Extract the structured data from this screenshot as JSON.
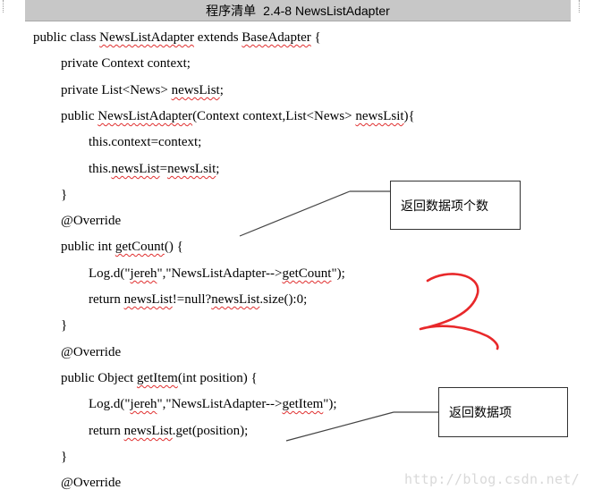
{
  "listing": {
    "label": "程序清单",
    "name": "2.4-8 NewsListAdapter"
  },
  "lines": [
    [
      "public class ",
      {
        "w": "NewsListAdapter"
      },
      " extends ",
      {
        "w": "BaseAdapter"
      },
      " {"
    ],
    [
      "private Context context;"
    ],
    [
      "private List<News> ",
      {
        "w": "newsList"
      },
      ";"
    ],
    [
      "public ",
      {
        "w": "NewsListAdapter"
      },
      "(Context context,List<News> ",
      {
        "w": "newsLsit"
      },
      "){"
    ],
    [
      "this.context=context;"
    ],
    [
      "this.",
      {
        "w": "newsList"
      },
      "=",
      {
        "w": "newsLsit"
      },
      ";"
    ],
    [
      "}"
    ],
    [
      "@Override"
    ],
    [
      "public int ",
      {
        "w": "getCount"
      },
      "() {"
    ],
    [
      "Log.d(\"",
      {
        "w": "jereh"
      },
      "\",\"NewsListAdapter-->",
      {
        "w": "getCount"
      },
      "\");"
    ],
    [
      "return ",
      {
        "w": "newsList"
      },
      "!=null?",
      {
        "w": "newsList"
      },
      ".size():0;"
    ],
    [
      "}"
    ],
    [
      "@Override"
    ],
    [
      "public Object ",
      {
        "w": "getItem"
      },
      "(int position) {"
    ],
    [
      "Log.d(\"",
      {
        "w": "jereh"
      },
      "\",\"NewsListAdapter-->",
      {
        "w": "getItem"
      },
      "\");"
    ],
    [
      "return ",
      {
        "w": "newsList"
      },
      ".get(position);"
    ],
    [
      "}"
    ],
    [
      "@Override"
    ]
  ],
  "callouts": {
    "count": "返回数据项个数",
    "item": "返回数据项"
  },
  "annotation": {
    "text": "2",
    "color": "#e8282a"
  },
  "watermark": "http://blog.csdn.net/"
}
